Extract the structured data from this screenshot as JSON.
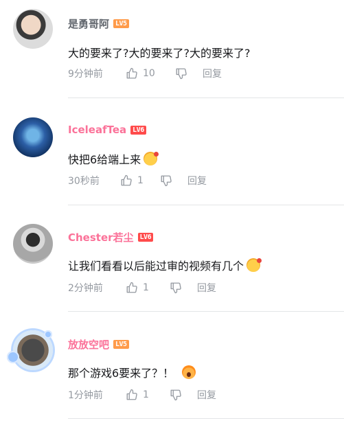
{
  "comments": [
    {
      "username": "是勇哥阿",
      "level": "LV5",
      "text": "大的要来了?大的要来了?大的要来了?",
      "time": "9分钟前",
      "likes": "10",
      "reply_label": "回复"
    },
    {
      "username": "IceleafTea",
      "level": "LV6",
      "text": "快把6给端上来",
      "time": "30秒前",
      "likes": "1",
      "reply_label": "回复"
    },
    {
      "username": "Chester若尘",
      "level": "LV6",
      "text": "让我们看看以后能过审的视频有几个",
      "time": "2分钟前",
      "likes": "1",
      "reply_label": "回复"
    },
    {
      "username": "放放空吧",
      "level": "LV5",
      "text": "那个游戏6要来了？！",
      "time": "1分钟前",
      "likes": "1",
      "reply_label": "回复"
    }
  ],
  "colors": {
    "username_default": "#61666d",
    "username_vip": "#fb7299",
    "meta": "#9499a0",
    "level5": "#ff9b4a",
    "level6": "#ff4b4b"
  },
  "icons": {
    "like": "thumbs-up-icon",
    "dislike": "thumbs-down-icon",
    "reaction": "emoji-icon"
  }
}
